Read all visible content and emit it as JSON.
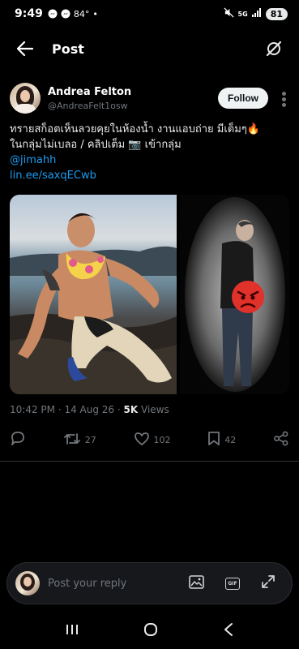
{
  "status": {
    "time": "9:49",
    "temp": "84°",
    "battery": "81",
    "net": "5G"
  },
  "header": {
    "title": "Post"
  },
  "author": {
    "display_name": "Andrea Felton",
    "handle": "@AndreaFelt1osw",
    "follow_label": "Follow"
  },
  "tweet": {
    "line1": "ทรายสก็อตเห็นลวยคุยในห้องน้ำ งานแอบถ่าย  มีเต็มๆ🔥",
    "line2": "ในกลุ่มไม่เบลอ / คลิปเต็ม 📷 เข้ากลุ่ม",
    "mention": "@jimahh",
    "link": "lin.ee/saxqECwb"
  },
  "meta": {
    "time": "10:42 PM",
    "date": "14 Aug 26",
    "views_count": "5K",
    "views_label": "Views"
  },
  "actions": {
    "retweets": "27",
    "likes": "102",
    "bookmarks": "42"
  },
  "reply": {
    "placeholder": "Post your reply"
  },
  "colors": {
    "accent": "#1d9bf0",
    "muted": "#71767b",
    "background": "#000000"
  },
  "icons": [
    "back-arrow-icon",
    "grok-icon",
    "reply-icon",
    "retweet-icon",
    "like-icon",
    "bookmark-icon",
    "share-icon",
    "image-icon",
    "gif-icon",
    "expand-icon"
  ]
}
